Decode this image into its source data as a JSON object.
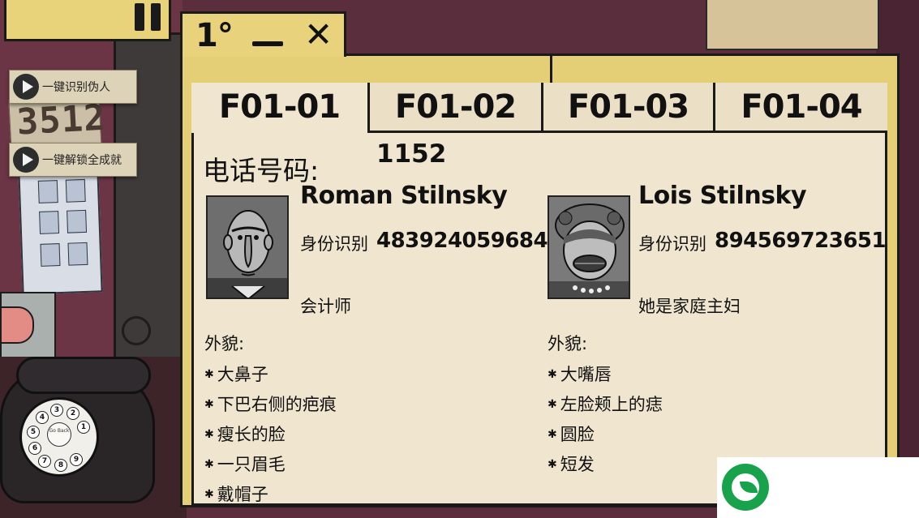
{
  "window": {
    "tab_number": "1°",
    "minimize_label": "",
    "close_label": "✕"
  },
  "tabs": [
    {
      "label": "F01-01",
      "active": true
    },
    {
      "label": "F01-02",
      "active": false
    },
    {
      "label": "F01-03",
      "active": false
    },
    {
      "label": "F01-04",
      "active": false
    }
  ],
  "phone": {
    "label": "电话号码:",
    "value": "1152"
  },
  "side_buttons": [
    {
      "label": "一键识别伪人"
    },
    {
      "label": "一键解锁全成就"
    }
  ],
  "wall_note": "3512",
  "dial": {
    "center_text": "Go Back",
    "numbers": [
      "1",
      "2",
      "3",
      "4",
      "5",
      "6",
      "7",
      "8",
      "9"
    ]
  },
  "persons": [
    {
      "name": "Roman Stilnsky",
      "id_label": "身份识别",
      "id_value": "483924059684",
      "occupation": "会计师",
      "appearance_label": "外貌:",
      "traits": [
        "大鼻子",
        "下巴右侧的疤痕",
        "瘦长的脸",
        "一只眉毛",
        "戴帽子"
      ]
    },
    {
      "name": "Lois Stilnsky",
      "id_label": "身份识别",
      "id_value": "894569723651",
      "occupation": "她是家庭主妇",
      "appearance_label": "外貌:",
      "traits": [
        "大嘴唇",
        "左脸颊上的痣",
        "圆脸",
        "短发"
      ]
    }
  ],
  "colors": {
    "folder": "#e5cf76",
    "paper": "#f0e6d0",
    "wall": "#6b3546",
    "watermark_green": "#19a24c"
  },
  "icons": {
    "pause": "pause-icon",
    "play": "play-icon",
    "minimize": "minimize-icon",
    "close": "close-icon",
    "trait_bullet": "star-bullet-icon",
    "logo": "leaf-logo-icon"
  }
}
